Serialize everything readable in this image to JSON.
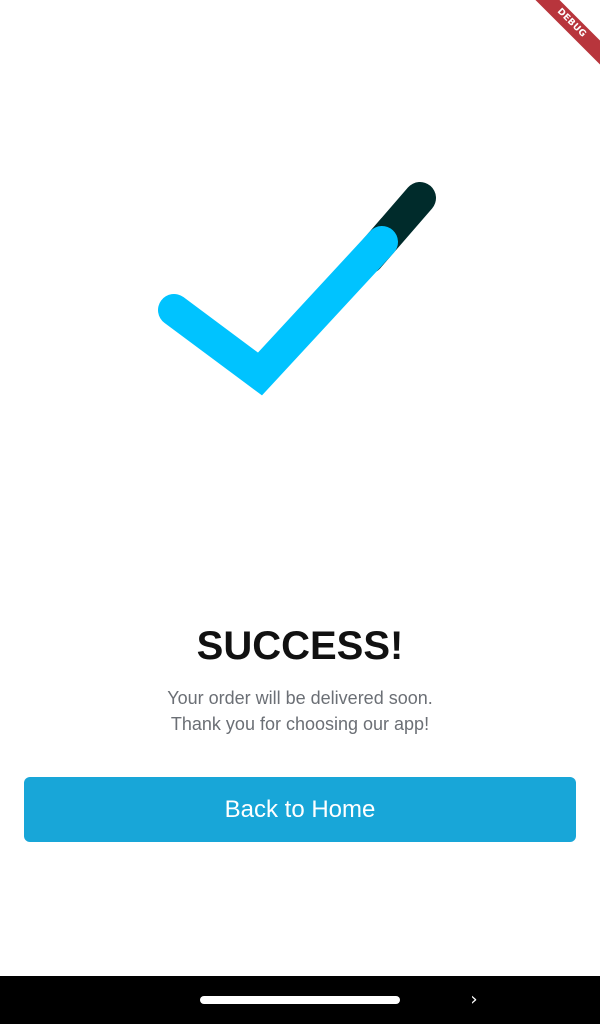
{
  "debug_banner": {
    "label": "DEBUG"
  },
  "success_screen": {
    "title": "SUCCESS!",
    "message_lines": [
      "Your order will be delivered soon.",
      "Thank you for choosing our app!"
    ],
    "back_button_label": "Back to Home"
  },
  "icons": {
    "checkmark": "checkmark-icon",
    "nav_chevron": "chevron-right-icon"
  },
  "colors": {
    "accent": "#18a6d8",
    "check_primary": "#00c3ff",
    "check_dark": "#002b2b",
    "title": "#111111",
    "subtitle": "#6b6f75",
    "debug_ribbon": "#b8353c"
  },
  "nav_bar": {
    "chevron_glyph": "›"
  }
}
